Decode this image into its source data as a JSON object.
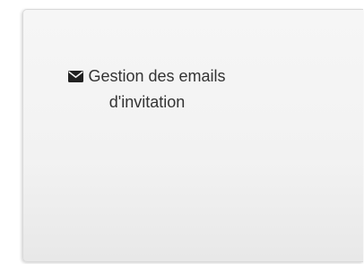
{
  "tile": {
    "title_line1": "Gestion des emails",
    "title_line2": "d'invitation",
    "icon": "envelope-icon"
  }
}
